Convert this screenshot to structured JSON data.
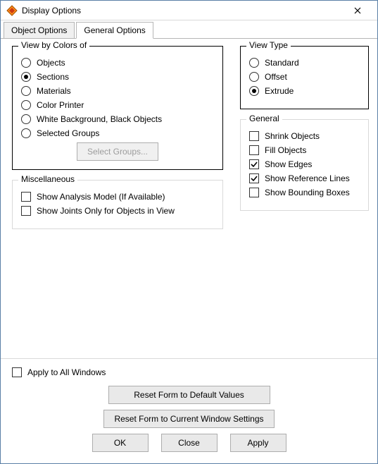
{
  "window": {
    "title": "Display Options"
  },
  "tabs": {
    "object_options": "Object Options",
    "general_options": "General Options"
  },
  "view_by_colors": {
    "legend": "View by Colors of",
    "objects": "Objects",
    "sections": "Sections",
    "materials": "Materials",
    "color_printer": "Color Printer",
    "white_bg": "White Background, Black Objects",
    "selected_groups": "Selected Groups",
    "select_groups_btn": "Select Groups..."
  },
  "miscellaneous": {
    "legend": "Miscellaneous",
    "show_analysis": "Show Analysis Model (If Available)",
    "show_joints": "Show Joints Only for Objects in View"
  },
  "view_type": {
    "legend": "View Type",
    "standard": "Standard",
    "offset": "Offset",
    "extrude": "Extrude"
  },
  "general": {
    "legend": "General",
    "shrink": "Shrink Objects",
    "fill": "Fill Objects",
    "show_edges": "Show Edges",
    "show_ref": "Show Reference Lines",
    "show_bbox": "Show Bounding Boxes"
  },
  "footer": {
    "apply_all": "Apply to All Windows",
    "reset_default": "Reset Form to Default Values",
    "reset_current": "Reset Form to Current Window Settings",
    "ok": "OK",
    "close": "Close",
    "apply": "Apply"
  }
}
